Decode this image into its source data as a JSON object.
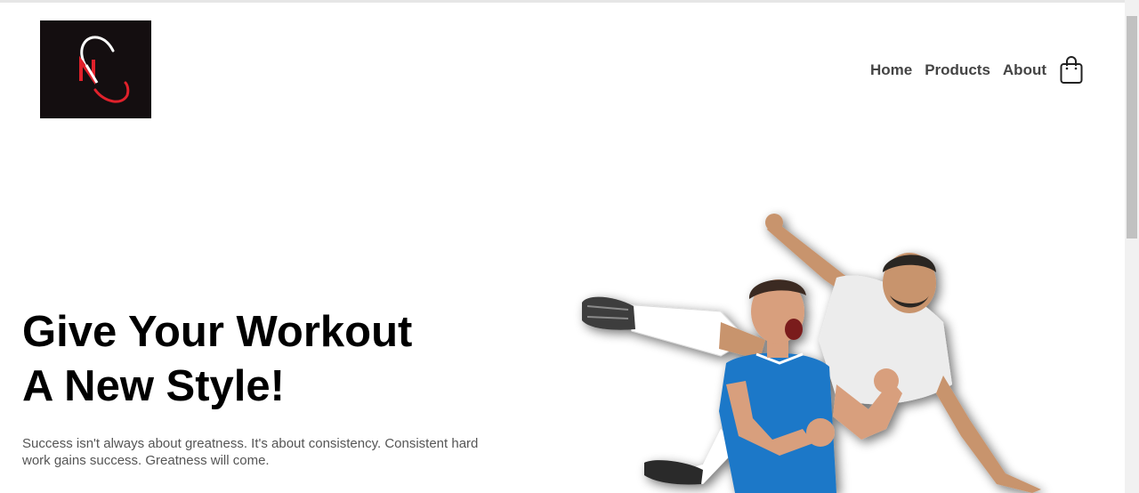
{
  "brand": {
    "logo_letter": "N",
    "logo_bg": "#140e10",
    "accent": "#e0212b"
  },
  "nav": {
    "items": [
      {
        "label": "Home"
      },
      {
        "label": "Products"
      },
      {
        "label": "About"
      }
    ],
    "cart_icon": "shopping-bag-icon"
  },
  "hero": {
    "title_line1": "Give Your Workout",
    "title_line2": "A New Style!",
    "text": "Success isn't always about greatness. It's about consistency. Consistent hard work gains success. Greatness will come.",
    "image": "two-athletes-celebrating"
  },
  "colors": {
    "jersey_blue": "#1f78c8",
    "jersey_white": "#eeeeee",
    "nav_text": "#444444"
  }
}
